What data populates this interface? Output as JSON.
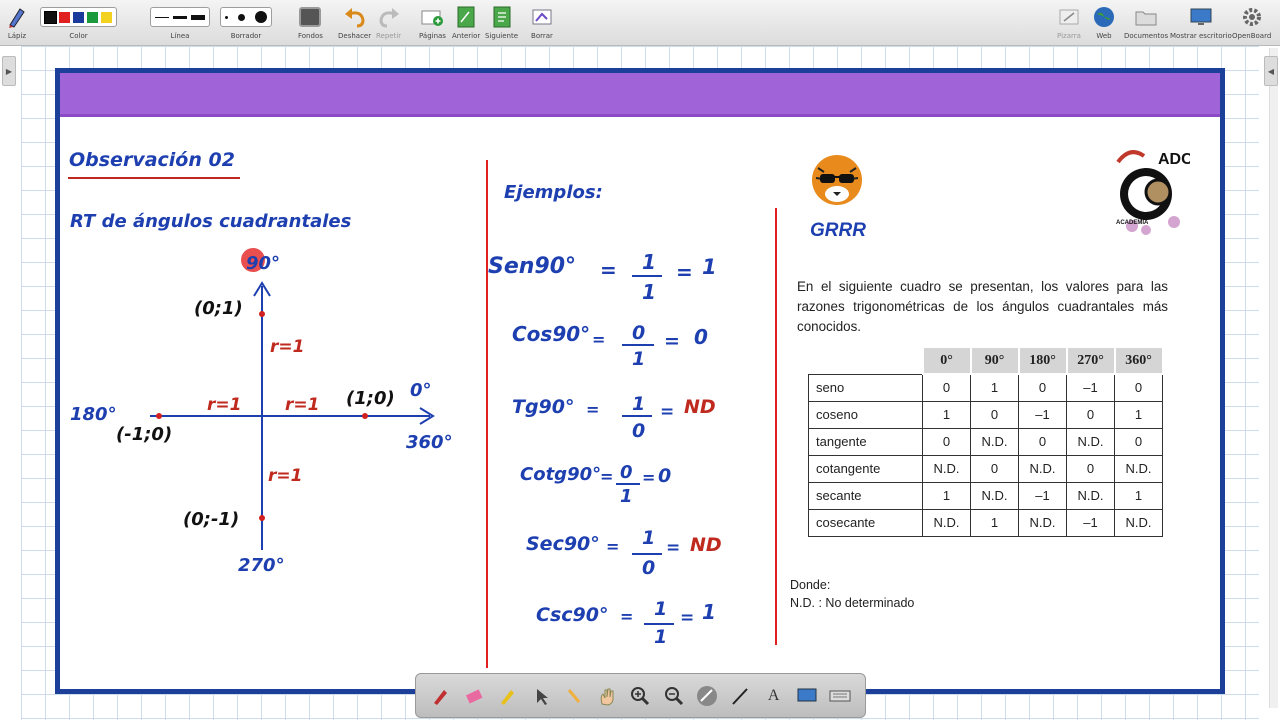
{
  "toolbar": {
    "items": [
      {
        "label": "Lápiz"
      },
      {
        "label": "Color"
      },
      {
        "label": "Línea"
      },
      {
        "label": "Borrador"
      },
      {
        "label": "Fondos"
      },
      {
        "label": "Deshacer"
      },
      {
        "label": "Repetir"
      },
      {
        "label": "Páginas"
      },
      {
        "label": "Anterior"
      },
      {
        "label": "Siguiente"
      },
      {
        "label": "Borrar"
      },
      {
        "label": "Pizarra"
      },
      {
        "label": "Web"
      },
      {
        "label": "Documentos"
      },
      {
        "label": "Mostrar escritorio"
      },
      {
        "label": "OpenBoard"
      }
    ],
    "colors": [
      "#111111",
      "#e02020",
      "#1a3a9c",
      "#1a9a3a",
      "#f2d21e"
    ]
  },
  "board": {
    "left": {
      "title": "Observación 02",
      "subtitle": "RT de ángulos cuadrantales",
      "angles": {
        "a90": "90°",
        "a0": "0°",
        "a180": "180°",
        "a360": "360°",
        "a270": "270°"
      },
      "points": {
        "p_up": "(0;1)",
        "p_right": "(1;0)",
        "p_left": "(-1;0)",
        "p_down": "(0;-1)"
      },
      "radius": {
        "r_up": "r=1",
        "r_left": "r=1",
        "r_right": "r=1",
        "r_down": "r=1"
      }
    },
    "middle": {
      "heading": "Ejemplos:",
      "examples": [
        {
          "fn": "Sen90°",
          "num": "1",
          "den": "1",
          "result": "1",
          "result_color": "#1d3fb0"
        },
        {
          "fn": "Cos90°",
          "num": "0",
          "den": "1",
          "result": "0",
          "result_color": "#1d3fb0"
        },
        {
          "fn": "Tg90°",
          "num": "1",
          "den": "0",
          "result": "ND",
          "result_color": "#c0291e"
        },
        {
          "fn": "Cotg90°",
          "num": "0",
          "den": "1",
          "result": "0",
          "result_color": "#1d3fb0"
        },
        {
          "fn": "Sec90°",
          "num": "1",
          "den": "0",
          "result": "ND",
          "result_color": "#c0291e"
        },
        {
          "fn": "Csc90°",
          "num": "1",
          "den": "1",
          "result": "1",
          "result_color": "#1d3fb0"
        }
      ]
    },
    "right": {
      "mascot_label": "GRRR",
      "logo_text": "ADC",
      "logo_sub": "ACADEMIA",
      "paragraph": "En el siguiente cuadro se presentan, los valores para las razones trigonométricas de los ángulos cuadrantales más conocidos.",
      "table": {
        "headers": [
          "0°",
          "90°",
          "180°",
          "270°",
          "360°"
        ],
        "rows": [
          {
            "name": "seno",
            "values": [
              "0",
              "1",
              "0",
              "–1",
              "0"
            ]
          },
          {
            "name": "coseno",
            "values": [
              "1",
              "0",
              "–1",
              "0",
              "1"
            ]
          },
          {
            "name": "tangente",
            "values": [
              "0",
              "N.D.",
              "0",
              "N.D.",
              "0"
            ]
          },
          {
            "name": "cotangente",
            "values": [
              "N.D.",
              "0",
              "N.D.",
              "0",
              "N.D."
            ]
          },
          {
            "name": "secante",
            "values": [
              "1",
              "N.D.",
              "–1",
              "N.D.",
              "1"
            ]
          },
          {
            "name": "cosecante",
            "values": [
              "N.D.",
              "1",
              "N.D.",
              "–1",
              "N.D."
            ]
          }
        ]
      },
      "donde": "Donde:",
      "nd_def": "N.D. : No determinado"
    }
  },
  "dock": {
    "tools": [
      "pen-icon",
      "eraser-icon",
      "marker-icon",
      "pointer-icon",
      "laser-icon",
      "hand-icon",
      "zoom-in-icon",
      "zoom-out-icon",
      "capture-icon",
      "line-icon",
      "text-icon",
      "screen-icon",
      "keyboard-icon"
    ]
  }
}
